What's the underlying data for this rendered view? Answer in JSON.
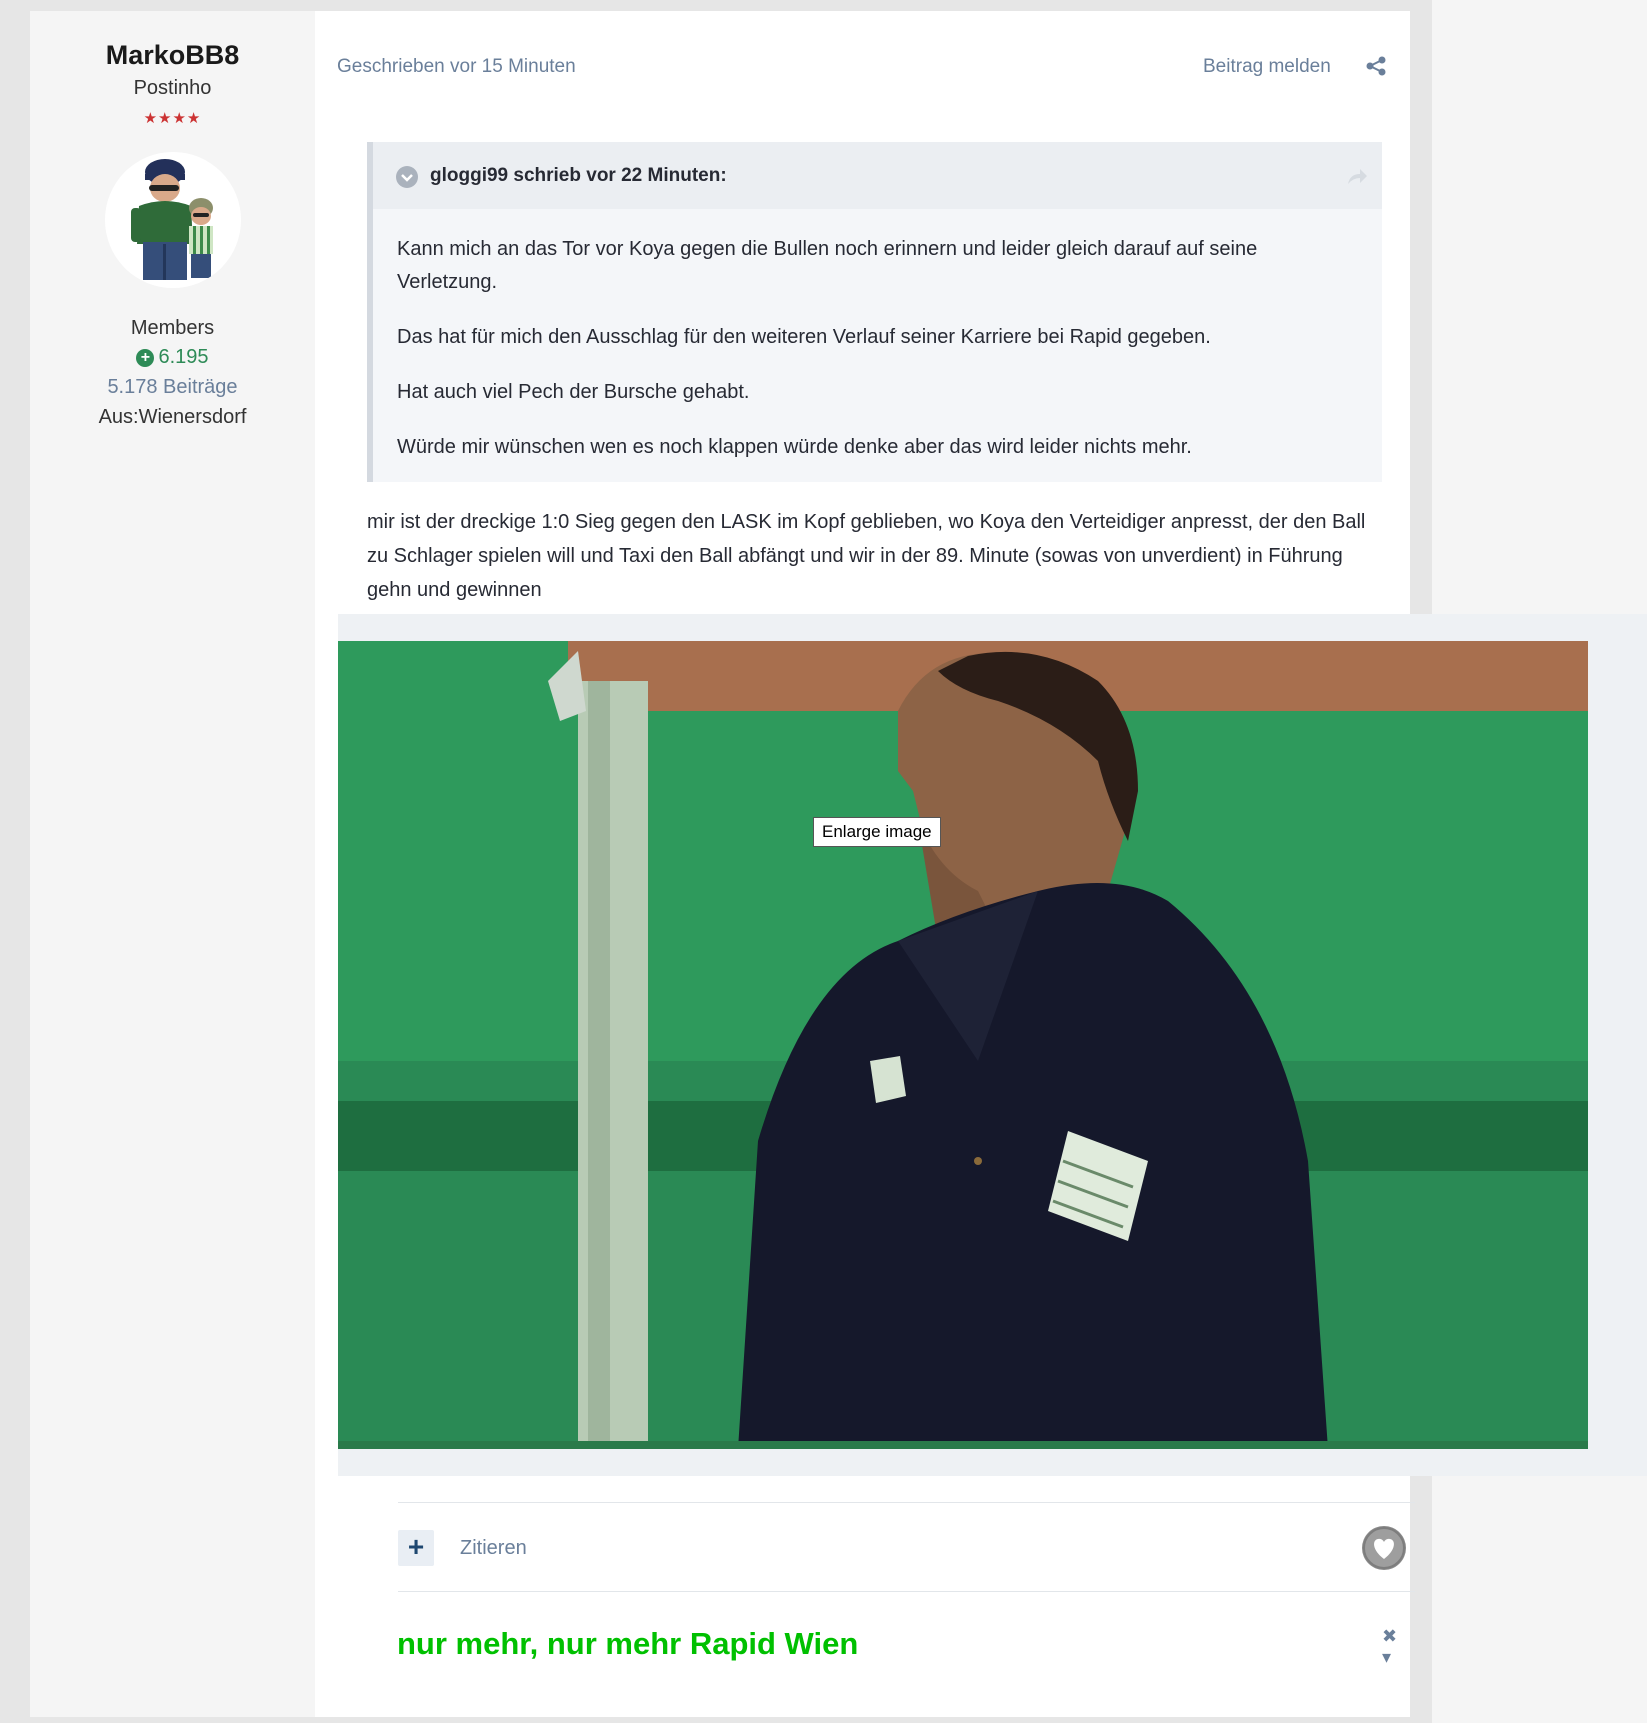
{
  "author": {
    "name": "MarkoBB8",
    "rank": "Postinho",
    "stars": "★★★★",
    "group": "Members",
    "reputation": "6.195",
    "posts": "5.178 Beiträge",
    "location": "Aus:Wienersdorf"
  },
  "meta": {
    "time": "Geschrieben vor 15 Minuten",
    "report": "Beitrag melden"
  },
  "quote": {
    "author_line": "gloggi99 schrieb vor 22 Minuten:",
    "paragraphs": [
      "Kann mich an das Tor vor Koya gegen die Bullen noch erinnern und leider gleich darauf auf seine Verletzung.",
      "Das hat für mich den Ausschlag für den weiteren Verlauf seiner Karriere bei Rapid gegeben.",
      "Hat auch viel Pech der Bursche gehabt.",
      "Würde mir wünschen wen es noch klappen würde denke aber das wird leider nichts mehr."
    ]
  },
  "body": {
    "text": "mir ist der dreckige 1:0 Sieg gegen den LASK im Kopf geblieben, wo Koya den Verteidiger anpresst, der den Ball zu Schlager spielen will und Taxi den Ball abfängt und wir in der 89. Minute (sowas von unverdient) in Führung gehn und gewinnen"
  },
  "image": {
    "tooltip": "Enlarge image"
  },
  "actions": {
    "plus": "+",
    "quote": "Zitieren"
  },
  "signature": {
    "text": "nur mehr, nur mehr Rapid Wien",
    "toggle": "✖ ▾"
  },
  "colors": {
    "signature": "#00c000",
    "reputation": "#2e8b57",
    "stars": "#cc3333",
    "meta": "#6a7f9a"
  }
}
